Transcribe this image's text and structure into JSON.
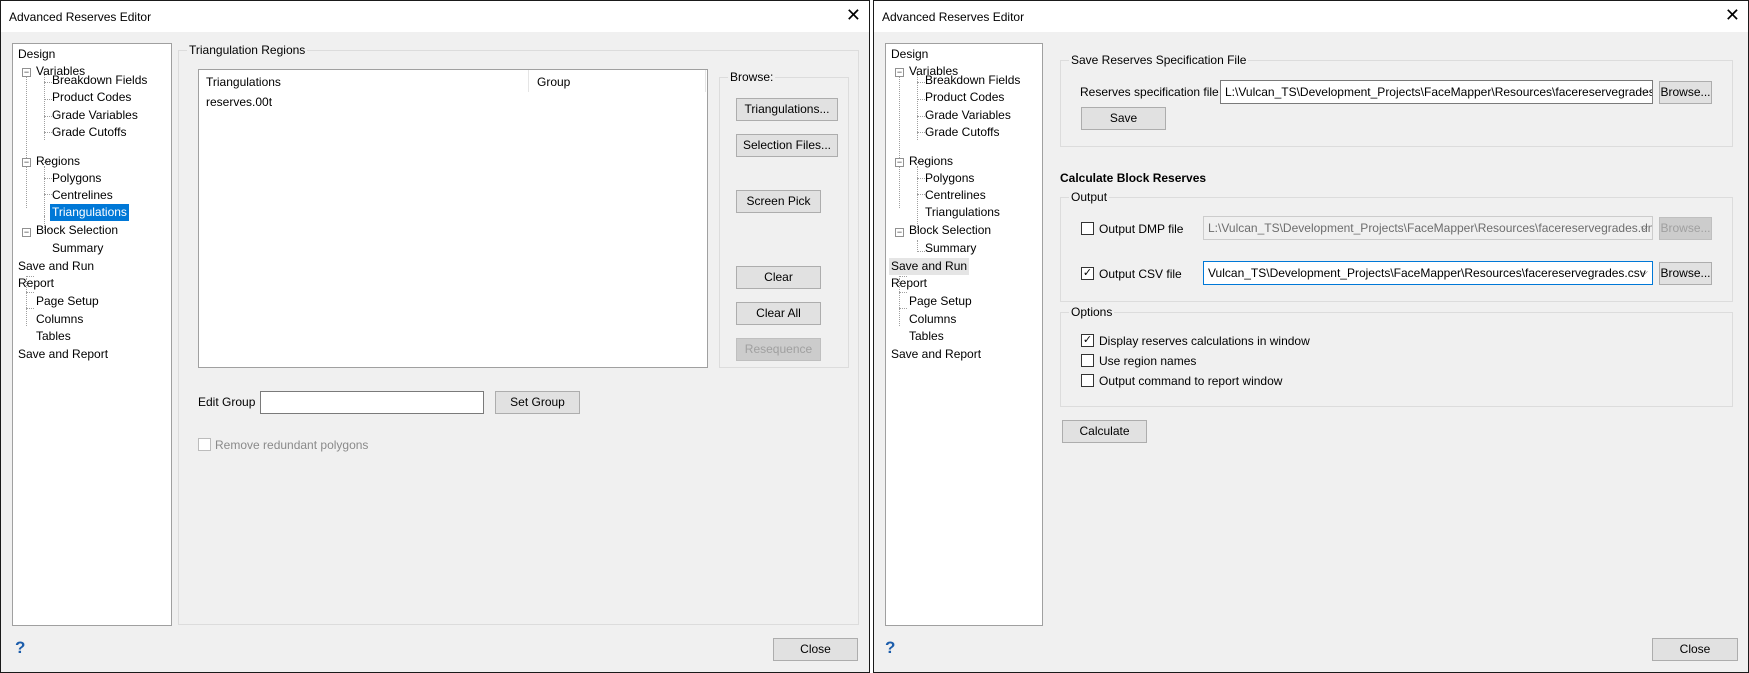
{
  "left_window": {
    "title": "Advanced Reserves Editor",
    "tree": {
      "design": "Design",
      "variables": "Variables",
      "breakdown_fields": "Breakdown Fields",
      "product_codes": "Product Codes",
      "grade_variables": "Grade Variables",
      "grade_cutoffs": "Grade Cutoffs",
      "regions": "Regions",
      "polygons": "Polygons",
      "centrelines": "Centrelines",
      "triangulations": "Triangulations",
      "block_selection": "Block Selection",
      "summary": "Summary",
      "save_and_run": "Save and Run",
      "report": "Report",
      "page_setup": "Page Setup",
      "columns": "Columns",
      "tables": "Tables",
      "save_and_report": "Save and Report"
    },
    "group_title": "Triangulation Regions",
    "list": {
      "columns": [
        "Triangulations",
        "Group"
      ],
      "rows": [
        [
          "reserves.00t",
          ""
        ]
      ]
    },
    "browse": {
      "title": "Browse:",
      "triangulations": "Triangulations...",
      "selection_files": "Selection Files...",
      "screen_pick": "Screen Pick",
      "clear": "Clear",
      "clear_all": "Clear All",
      "resequence": "Resequence"
    },
    "edit_group_label": "Edit Group",
    "edit_group_value": "",
    "set_group": "Set Group",
    "remove_redundant": "Remove redundant polygons",
    "help": "?",
    "close": "Close"
  },
  "right_window": {
    "title": "Advanced Reserves Editor",
    "save_group_title": "Save Reserves Specification File",
    "spec_label": "Reserves specification file",
    "spec_value": "L:\\Vulcan_TS\\Development_Projects\\FaceMapper\\Resources\\facereservegrades.res",
    "browse": "Browse...",
    "save": "Save",
    "calc_heading": "Calculate Block Reserves",
    "output_title": "Output",
    "dmp_label": "Output DMP file",
    "dmp_checked": false,
    "dmp_value": "L:\\Vulcan_TS\\Development_Projects\\FaceMapper\\Resources\\facereservegrades.dmp",
    "csv_label": "Output CSV file",
    "csv_checked": true,
    "csv_value": "Vulcan_TS\\Development_Projects\\FaceMapper\\Resources\\facereservegrades.csv",
    "options_title": "Options",
    "opt_display": "Display reserves calculations in window",
    "opt_region_names": "Use region names",
    "opt_output_cmd": "Output command to report window",
    "calculate": "Calculate",
    "help": "?",
    "close": "Close"
  }
}
